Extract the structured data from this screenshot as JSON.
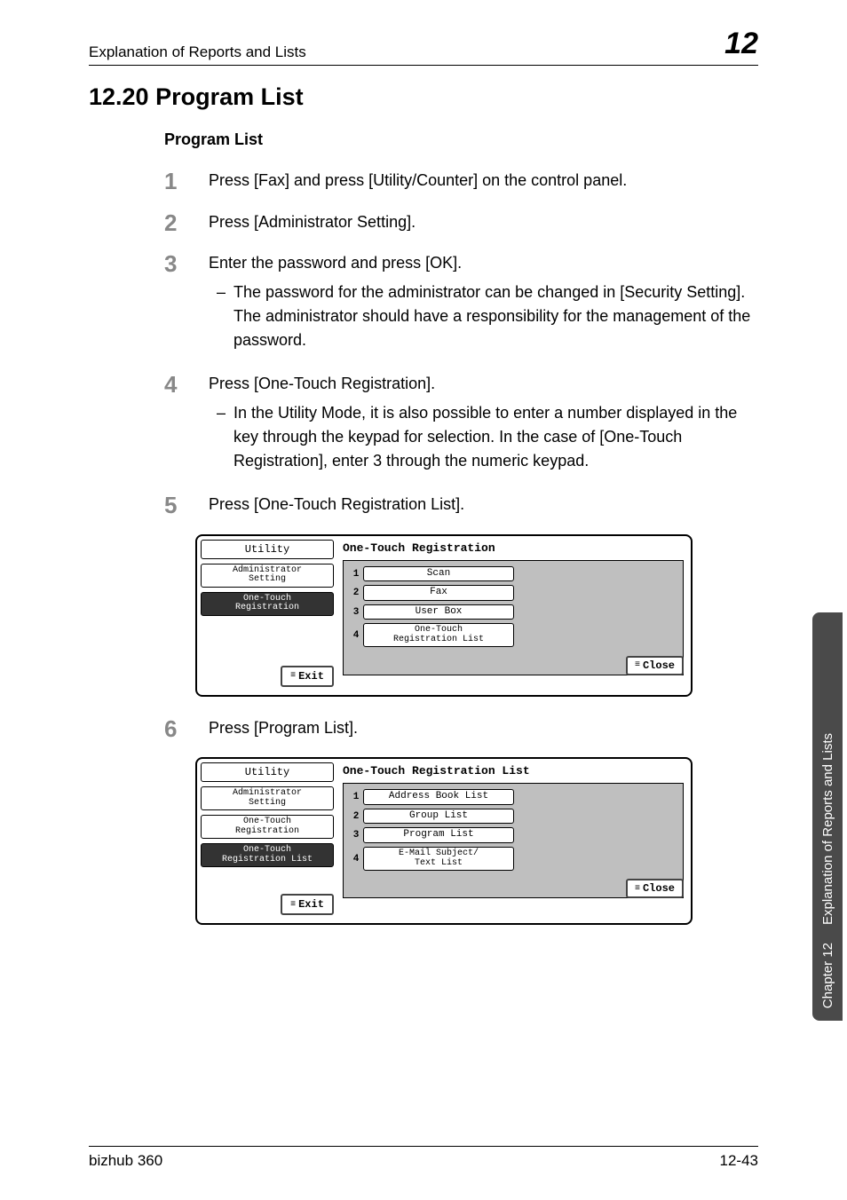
{
  "header": {
    "left": "Explanation of Reports and Lists",
    "right": "12"
  },
  "section_title": "12.20 Program List",
  "subhead": "Program List",
  "steps": {
    "s1": {
      "num": "1",
      "text": "Press [Fax] and press [Utility/Counter] on the control panel."
    },
    "s2": {
      "num": "2",
      "text": "Press [Administrator Setting]."
    },
    "s3": {
      "num": "3",
      "text": "Enter the password and press [OK].",
      "sub1": "The password for the administrator can be changed in [Security Setting]. The administrator should have a responsibility for the management of the password."
    },
    "s4": {
      "num": "4",
      "text": "Press [One-Touch Registration].",
      "sub1": "In the Utility Mode, it is also possible to enter a number displayed in the key through the keypad for selection. In the case of [One-Touch Registration], enter 3 through the numeric keypad."
    },
    "s5": {
      "num": "5",
      "text": "Press [One-Touch Registration List]."
    },
    "s6": {
      "num": "6",
      "text": "Press [Program List]."
    }
  },
  "screen1": {
    "left": {
      "utility": "Utility",
      "admin": "Administrator\nSetting",
      "onetouch": "One-Touch\nRegistration",
      "exit": "Exit"
    },
    "title": "One-Touch Registration",
    "opts": {
      "n1": "1",
      "b1": "Scan",
      "n2": "2",
      "b2": "Fax",
      "n3": "3",
      "b3": "User Box",
      "n4": "4",
      "b4": "One-Touch\nRegistration List"
    },
    "close": "Close"
  },
  "screen2": {
    "left": {
      "utility": "Utility",
      "admin": "Administrator\nSetting",
      "onetouch": "One-Touch\nRegistration",
      "onetouch_list": "One-Touch\nRegistration List",
      "exit": "Exit"
    },
    "title": "One-Touch Registration List",
    "opts": {
      "n1": "1",
      "b1": "Address Book List",
      "n2": "2",
      "b2": "Group List",
      "n3": "3",
      "b3": "Program List",
      "n4": "4",
      "b4": "E-Mail Subject/\nText List"
    },
    "close": "Close"
  },
  "side_tab": {
    "t1": "Chapter 12",
    "t2": "Explanation of Reports and Lists"
  },
  "footer": {
    "left": "bizhub 360",
    "right": "12-43"
  }
}
